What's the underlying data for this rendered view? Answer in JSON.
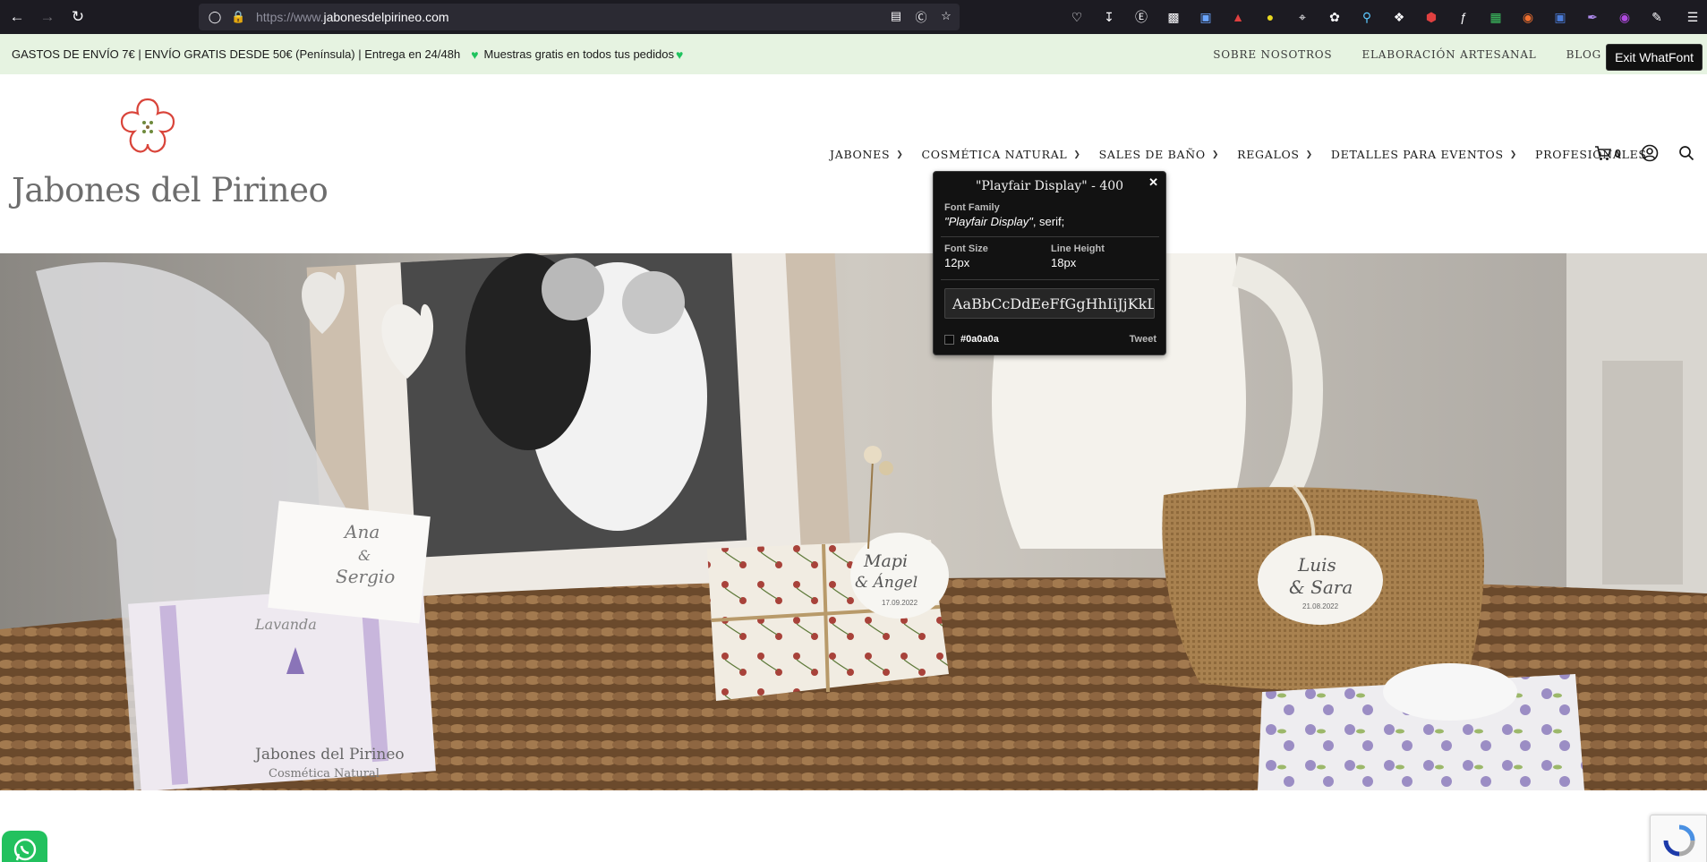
{
  "browser": {
    "url_prefix": "https://www.",
    "url_domain": "jabonesdelpirineo.com"
  },
  "topbar": {
    "shipping_text": "GASTOS DE ENVÍO 7€ | ENVÍO GRATIS DESDE 50€ (Península) | Entrega en 24/48h",
    "samples_text": "Muestras gratis en todos tus pedidos",
    "links": [
      "SOBRE NOSOTROS",
      "ELABORACIÓN ARTESANAL",
      "BLOG"
    ],
    "exit_whatfont_label": "Exit WhatFont"
  },
  "header": {
    "logo_text": "Jabones del Pirineo",
    "nav": [
      "JABONES",
      "COSMÉTICA NATURAL",
      "SALES DE BAÑO",
      "REGALOS",
      "DETALLES PARA EVENTOS",
      "PROFESIONALES"
    ],
    "cart_count": "0"
  },
  "whatfont": {
    "title": "\"Playfair Display\" - 400",
    "family_label": "Font Family",
    "family_name": "\"Playfair Display\"",
    "family_fallback": ", serif;",
    "size_label": "Font Size",
    "size_value": "12px",
    "line_height_label": "Line Height",
    "line_height_value": "18px",
    "sample": "AaBbCcDdEeFfGgHhIiJjKkLlMmNnOoPp",
    "color": "#0a0a0a",
    "tweet_label": "Tweet"
  },
  "hero": {
    "tag_1_line1": "Ana",
    "tag_1_line2": "&",
    "tag_1_line3": "Sergio",
    "tag_2_line1": "Mapi",
    "tag_2_line2": "& Ángel",
    "tag_2_date": "17.09.2022",
    "tag_3_line1": "Luis",
    "tag_3_line2": "& Sara",
    "tag_3_date": "21.08.2022",
    "soap_label": "Lavanda",
    "box_brand": "Jabones del Pirineo",
    "box_sub": "Cosmética Natural"
  },
  "colors": {
    "topbar_bg": "#e6f3e1",
    "heart": "#1fc35e",
    "logo_flower": "#d9443a",
    "whatsapp": "#22c15e"
  }
}
